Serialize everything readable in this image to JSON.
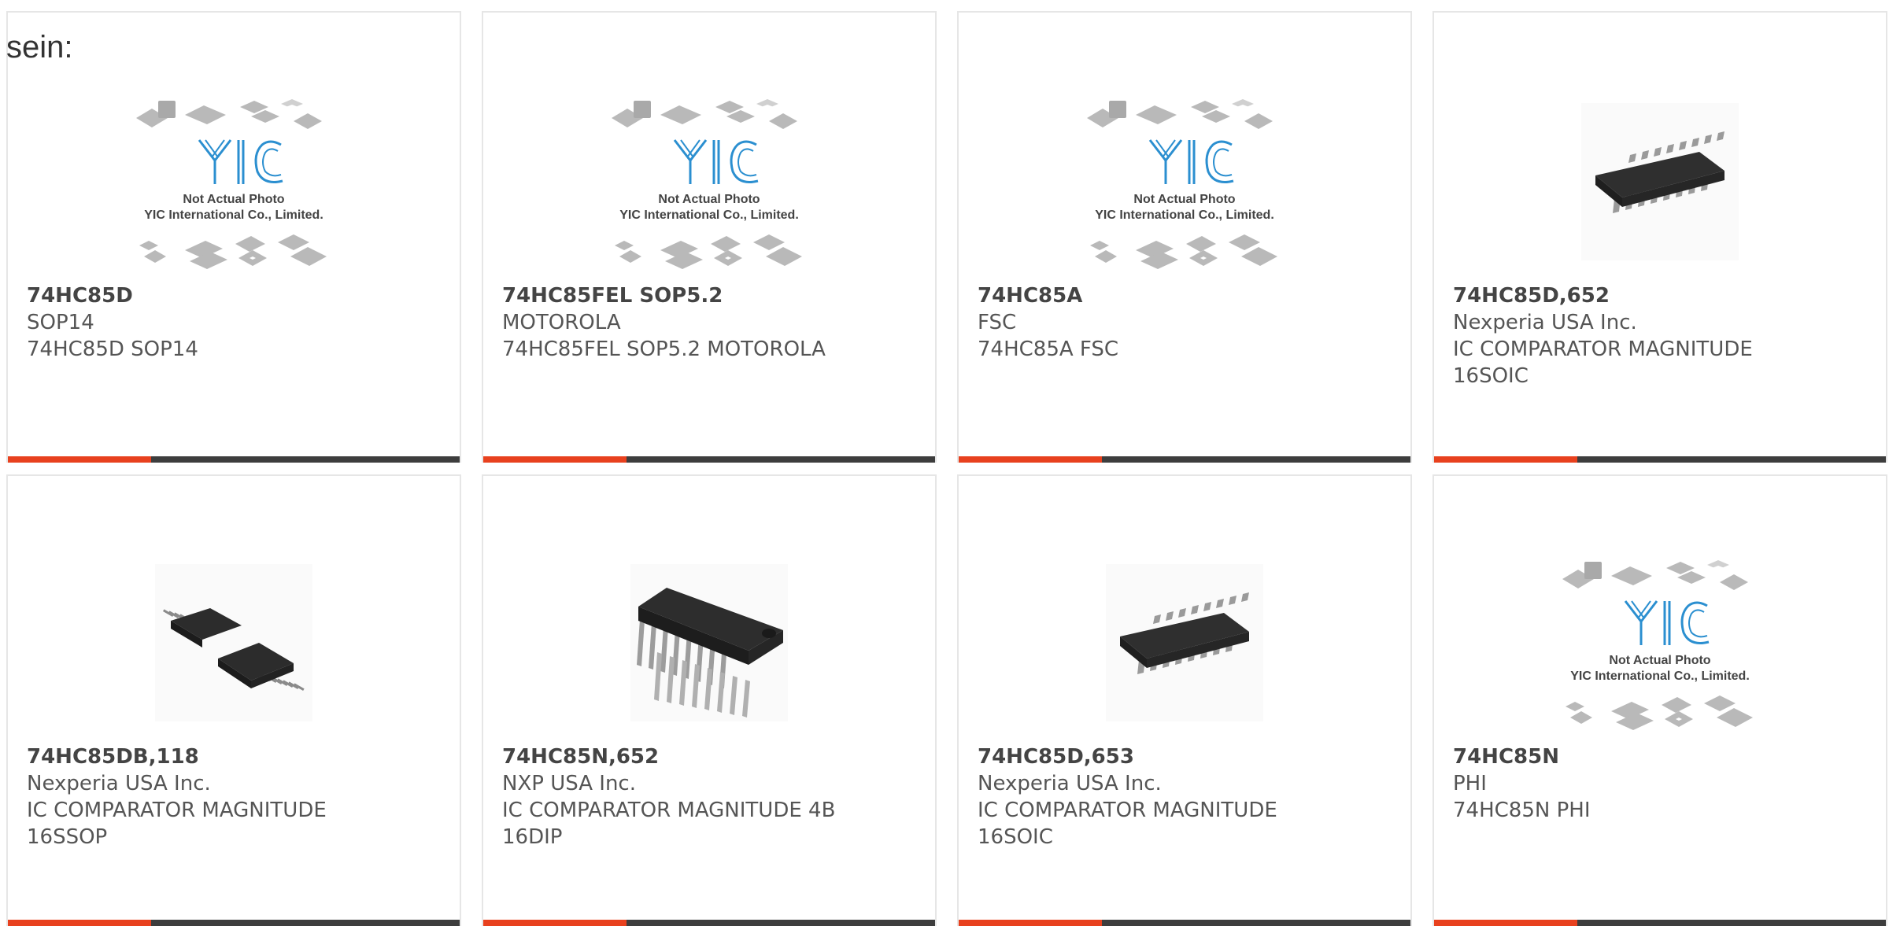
{
  "intro_text": "sein:",
  "placeholder": {
    "caption_line1": "Not Actual Photo",
    "caption_line2": "YIC International Co., Limited.",
    "logo_text": "YIC"
  },
  "colors": {
    "accent": "#e8411e",
    "bar": "#3d3d3d",
    "logo_blue": "#2b8fd0",
    "text": "#555555"
  },
  "products": [
    {
      "title": "74HC85D",
      "lines": [
        "SOP14",
        "74HC85D SOP14"
      ],
      "image": "placeholder-logo"
    },
    {
      "title": "74HC85FEL SOP5.2",
      "lines": [
        "MOTOROLA",
        "74HC85FEL SOP5.2 MOTOROLA"
      ],
      "image": "placeholder-logo"
    },
    {
      "title": "74HC85A",
      "lines": [
        "FSC",
        "74HC85A FSC"
      ],
      "image": "placeholder-logo"
    },
    {
      "title": "74HC85D,652",
      "lines": [
        "Nexperia USA Inc.",
        "IC COMPARATOR MAGNITUDE",
        "16SOIC"
      ],
      "image": "soic-chip"
    },
    {
      "title": "74HC85DB,118",
      "lines": [
        "Nexperia USA Inc.",
        "IC COMPARATOR MAGNITUDE",
        "16SSOP"
      ],
      "image": "ssop-chips"
    },
    {
      "title": "74HC85N,652",
      "lines": [
        "NXP USA Inc.",
        "IC COMPARATOR MAGNITUDE 4B",
        "16DIP"
      ],
      "image": "dip-chip"
    },
    {
      "title": "74HC85D,653",
      "lines": [
        "Nexperia USA Inc.",
        "IC COMPARATOR MAGNITUDE",
        "16SOIC"
      ],
      "image": "soic-chip"
    },
    {
      "title": "74HC85N",
      "lines": [
        "PHI",
        "74HC85N PHI"
      ],
      "image": "placeholder-logo"
    }
  ]
}
